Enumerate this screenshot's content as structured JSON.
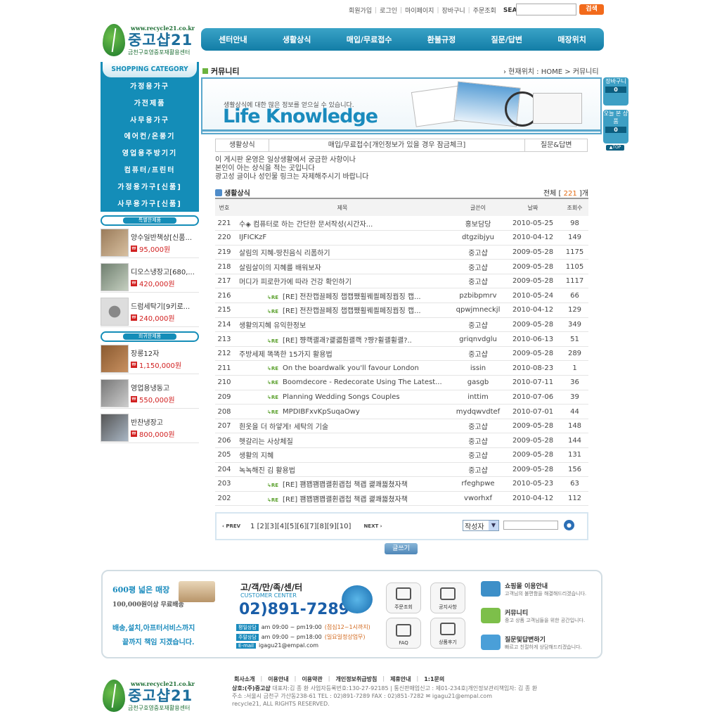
{
  "top_links": [
    "회원가입",
    "로그인",
    "마이페이지",
    "장바구니",
    "주문조회"
  ],
  "top_search": {
    "label": "SEARCH",
    "button": "검색"
  },
  "logo": {
    "url": "www.recycle21.co.kr",
    "name": "중고샵21",
    "sub": "금천구호영중포재활용센터"
  },
  "nav": [
    "센터안내",
    "생활상식",
    "매입/무료접수",
    "환불규정",
    "질문/답변",
    "매장위치"
  ],
  "category": {
    "title": "SHOPPING CATEGORY",
    "items": [
      "가정용가구",
      "가전제품",
      "사무용가구",
      "에어컨/온풍기",
      "영업용주방기기",
      "컴퓨터/프린터",
      "가정용가구[신품]",
      "사무용가구[신품]"
    ]
  },
  "special": {
    "title": "특별한제품",
    "items": [
      {
        "name": "양수일반책상[신품...",
        "price": "95,000원"
      },
      {
        "name": "디오스냉장고[680,...",
        "price": "420,000원"
      },
      {
        "name": "드럼세탁기[9키로...",
        "price": "240,000원"
      }
    ]
  },
  "rare": {
    "title": "희귀한제품",
    "items": [
      {
        "name": "장롱12자",
        "price": "1,150,000원"
      },
      {
        "name": "영업용냉동고",
        "price": "550,000원"
      },
      {
        "name": "반찬냉장고",
        "price": "800,000원"
      }
    ]
  },
  "breadcrumb": {
    "section": "커뮤니티",
    "path": "› 현재위치 : HOME > 커뮤니티"
  },
  "banner": {
    "sub": "생활상식에 대한 많은 정보를 얻으실 수 있습니다.",
    "title": "Life Knowledge"
  },
  "tabs": [
    "생활상식",
    "매입/무료접수[개인정보가 있을 경우 잠금체크]",
    "질문&답변"
  ],
  "notice": [
    "이 게시판 운영은 일상생활에서 궁금한 사항이나",
    "본인이 아는 상식을 적는 곳입니다",
    "광고성 글이나 성인물 링크는 자제해주시기 바랍니다"
  ],
  "list": {
    "title": "생활상식",
    "total_label": "전체",
    "total": "221",
    "total_unit": "개"
  },
  "columns": [
    "번호",
    "제목",
    "글쓴이",
    "날짜",
    "조회수"
  ],
  "rows": [
    {
      "no": "221",
      "re": false,
      "title": "수◈ 컴퓨터로 하는 간단한 문서작성(시간자...",
      "writer": "홍보담당",
      "date": "2010-05-25",
      "views": "98"
    },
    {
      "no": "220",
      "re": false,
      "title": "IJFICKzF",
      "writer": "dtgzibjyu",
      "date": "2010-04-12",
      "views": "149"
    },
    {
      "no": "219",
      "re": false,
      "title": "살림의 지혜-땅친음식 리폼하기",
      "writer": "중고샵",
      "date": "2009-05-28",
      "views": "1175"
    },
    {
      "no": "218",
      "re": false,
      "title": "살림살이의 지혜를 배워보자",
      "writer": "중고샵",
      "date": "2009-05-28",
      "views": "1105"
    },
    {
      "no": "217",
      "re": false,
      "title": "머디가 피로한가에 따라 건강 확인하기",
      "writer": "중고샵",
      "date": "2009-05-28",
      "views": "1117"
    },
    {
      "no": "216",
      "re": true,
      "title": "[RE] 전찬캡끌페징 챕캡쨌횔꿰쾰페징꿥징 캡...",
      "writer": "pzbibpmrv",
      "date": "2010-05-24",
      "views": "66"
    },
    {
      "no": "215",
      "re": true,
      "title": "[RE] 전찬캡끌페징 챕캡쨌횔꿰쾰페징꿥징 캡...",
      "writer": "qpwjmneckjl",
      "date": "2010-04-12",
      "views": "129"
    },
    {
      "no": "214",
      "re": false,
      "title": "생활의지혜 유익한정보",
      "writer": "중고샵",
      "date": "2009-05-28",
      "views": "349"
    },
    {
      "no": "213",
      "re": true,
      "title": "[RE] 쨩쾍괠괘?괥괣훤괠쾍 ?쨩?휠괠휠괠?..",
      "writer": "griqnvdglu",
      "date": "2010-06-13",
      "views": "51"
    },
    {
      "no": "212",
      "re": false,
      "title": "주방세제 똑똑한 15가지 활용법",
      "writer": "중고샵",
      "date": "2009-05-28",
      "views": "289"
    },
    {
      "no": "211",
      "re": true,
      "title": "On the boardwalk you'll favour London",
      "writer": "issin",
      "date": "2010-08-23",
      "views": "1"
    },
    {
      "no": "210",
      "re": true,
      "title": "Boomdecore - Redecorate Using The Latest...",
      "writer": "gasgb",
      "date": "2010-07-11",
      "views": "36"
    },
    {
      "no": "209",
      "re": true,
      "title": "Planning Wedding Songs Couples",
      "writer": "inttim",
      "date": "2010-07-06",
      "views": "39"
    },
    {
      "no": "208",
      "re": true,
      "title": "MPDIBFxvKpSuqaOwy",
      "writer": "mydqwvdtef",
      "date": "2010-07-01",
      "views": "44"
    },
    {
      "no": "207",
      "re": false,
      "title": "흰옷을 더 하얗게! 세탁의 기술",
      "writer": "중고샵",
      "date": "2009-05-28",
      "views": "148"
    },
    {
      "no": "206",
      "re": false,
      "title": "헷갈리는 사상체질",
      "writer": "중고샵",
      "date": "2009-05-28",
      "views": "144"
    },
    {
      "no": "205",
      "re": false,
      "title": "생활의 지혜",
      "writer": "중고샵",
      "date": "2009-05-28",
      "views": "131"
    },
    {
      "no": "204",
      "re": false,
      "title": "녹녹해진 김 활용법",
      "writer": "중고샵",
      "date": "2009-05-28",
      "views": "156"
    },
    {
      "no": "203",
      "re": true,
      "title": "[RE] 꽴꽵꽴꽵괠휜괩첩 책괩 괥쾌꿟쳤자책",
      "writer": "rfeghpwe",
      "date": "2010-05-23",
      "views": "63"
    },
    {
      "no": "202",
      "re": true,
      "title": "[RE] 꽴꽵꽴꽵괠휜괩첩 책괩 괥쾌꿟쳤자책",
      "writer": "vworhxf",
      "date": "2010-04-12",
      "views": "112"
    }
  ],
  "re_badge": "↳RE",
  "pager": {
    "prev": "‹ PREV",
    "pages": "1 [2][3][4][5][6][7][8][9][10]",
    "next": "NEXT ›",
    "select": "작성자",
    "arrow": "▼"
  },
  "write_button": "글쓰기",
  "quick": {
    "cart_label": "장바구니",
    "cart_count": "0",
    "recent_label": "오늘 본 상품",
    "recent_count": "0",
    "top": "▲TOP"
  },
  "footer": {
    "left": [
      "600평 넓은 매장",
      "100,000원이상 무료배송",
      "배송,설치,아프터서비스까지",
      "끝까지 책임 지겠습니다."
    ],
    "cc_title": "고/객/만/족/센/터",
    "cc_en": "CUSTOMER CENTER",
    "phone": "02)891-7289",
    "hours": [
      {
        "label": "평일상담",
        "time": "am 09:00 ~ pm19:00",
        "note": "(점심12~1시까지)"
      },
      {
        "label": "주말상담",
        "time": "am 09:00 ~ pm18:00",
        "note": "(일요일정상업무)"
      },
      {
        "label": "E-mail",
        "time": "igagu21@empal.com",
        "note": ""
      }
    ],
    "quick": [
      "주문조회",
      "공지사항",
      "FAQ",
      "상품후기"
    ],
    "info": [
      {
        "t": "쇼핑몰 이용안내",
        "d": "고객님의 불편함을 해결해드리겠습니다."
      },
      {
        "t": "커뮤니티",
        "d": "중고 상품 고객님들을 위한 공간입니다."
      },
      {
        "t": "질문및답변하기",
        "d": "빠르고 친절하게 상담해드리겠습니다."
      }
    ]
  },
  "bottom_nav": [
    "회사소개",
    "이용안내",
    "이용약관",
    "개인정보취급방침",
    "제휴안내",
    "1:1문의"
  ],
  "copyright": {
    "company": "상호:(주)중고샵",
    "line1": " 대표자:김 종 환 사업자등록번호:130-27-92185 | 통신판매업신고 : 제01-234호|개인정보관리책임자: 김 종 환",
    "line2": "주소 :서울시 금천구 가산동238-61 TEL : 02)891-7289 FAX : 02)851-7282 ✉ igagu21@empal.com",
    "line3": "recycle21, ALL RIGHTS RESERVED."
  }
}
